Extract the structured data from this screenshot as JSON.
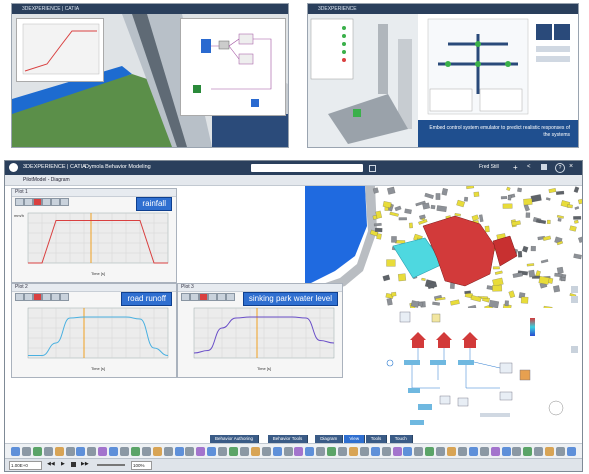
{
  "top_left_window": {
    "title": "3DEXPERIENCE | CATIA"
  },
  "top_right_window": {
    "title": "3DEXPERIENCE",
    "caption": "Embed control system emulator to predict realistic responses of the systems"
  },
  "main_window": {
    "brand": "3DEXPERIENCE | CATIA",
    "app_name": "Dymola Behavior Modeling",
    "breadcrumb": "PilotModel - Diagram",
    "user": "Fred Still",
    "search_placeholder": ""
  },
  "plots": [
    {
      "header": "Plot 1",
      "label": "rainfall",
      "xlabel": "Time [s]",
      "ylabel": "mm/h"
    },
    {
      "header": "Plot 2",
      "label": "road runoff",
      "xlabel": "Time [s]",
      "ylabel": ""
    },
    {
      "header": "Plot 3",
      "label": "sinking park water level",
      "xlabel": "Time [s]",
      "ylabel": ""
    }
  ],
  "bottom_tabs": [
    "Behavior Authoring",
    "Behavior Tools",
    "Diagram",
    "View",
    "Tools",
    "Touch"
  ],
  "active_tab": "View",
  "status_bar": {
    "time_value": "1.00E+0",
    "speed": "100%"
  },
  "chart_data": [
    {
      "type": "line",
      "title": "rainfall",
      "x": [
        0,
        10,
        20,
        30,
        40,
        50,
        60,
        70,
        80,
        90,
        100
      ],
      "series": [
        {
          "name": "",
          "values": [
            0,
            0,
            0.85,
            0.85,
            0.85,
            0.85,
            0.85,
            0.85,
            0.85,
            0,
            0
          ]
        }
      ],
      "color": "#d94040",
      "marker_x": 45
    },
    {
      "type": "line",
      "title": "road runoff",
      "x": [
        0,
        10,
        20,
        30,
        40,
        50,
        60,
        70,
        80,
        90,
        100
      ],
      "series": [
        {
          "name": "",
          "values": [
            0.05,
            0.05,
            0.3,
            0.8,
            0.82,
            0.82,
            0.82,
            0.82,
            0.78,
            0.2,
            0.05
          ]
        }
      ],
      "color": "#4ab0e0",
      "marker_x": 40
    },
    {
      "type": "line",
      "title": "sinking park water level",
      "x": [
        0,
        10,
        20,
        30,
        40,
        50,
        60,
        70,
        80,
        90,
        100
      ],
      "series": [
        {
          "name": "",
          "values": [
            0.1,
            0.15,
            0.6,
            0.8,
            0.82,
            0.82,
            0.82,
            0.82,
            0.8,
            0.35,
            0.3
          ]
        }
      ],
      "color": "#6a4fc8",
      "marker_x": 45
    }
  ],
  "colors": {
    "titlebar": "#2a3f5c",
    "label_blue": "#2f6fd0",
    "water": "#1f6ae0",
    "pool": "#4ed8e0",
    "buildings_red": "#d23a3a",
    "buildings_yellow": "#e8dc3a"
  }
}
